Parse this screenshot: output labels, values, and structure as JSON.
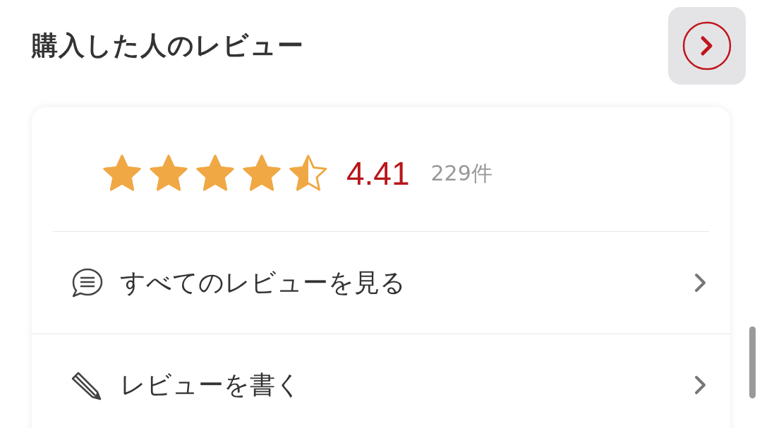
{
  "section": {
    "title": "購入した人のレビュー"
  },
  "rating": {
    "stars": 4.5,
    "score": "4.41",
    "count": "229件"
  },
  "links": [
    {
      "kind": "read",
      "label": "すべてのレビューを見る"
    },
    {
      "kind": "write",
      "label": "レビューを書く"
    }
  ]
}
